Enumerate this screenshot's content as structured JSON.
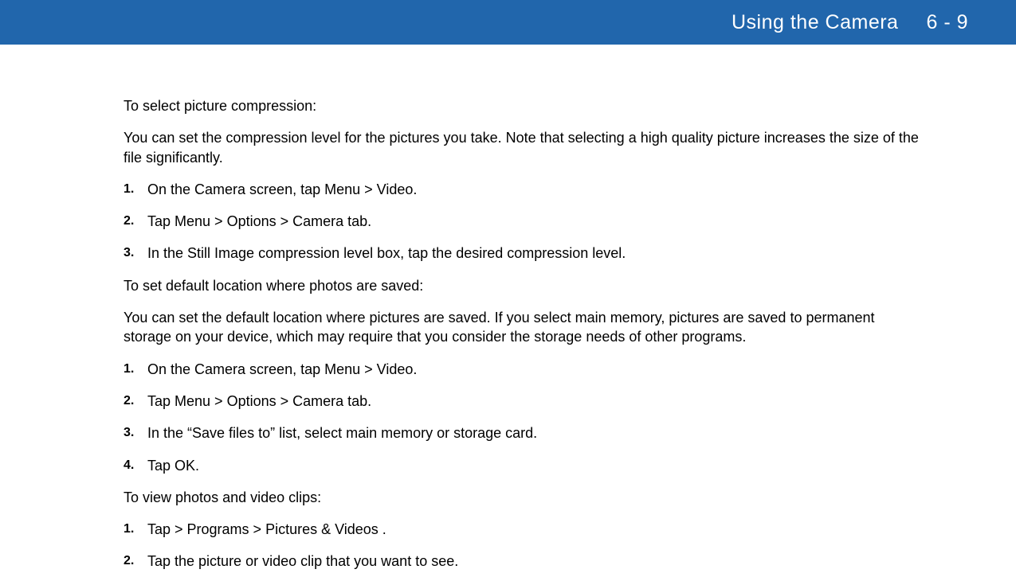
{
  "header": {
    "title": "Using the Camera",
    "page": "6 - 9"
  },
  "sections": [
    {
      "intro": "To select picture compression:",
      "desc": "You can set the compression level for the pictures you take. Note that selecting a high quality picture increases the size of the file significantly.",
      "steps": [
        "On the Camera screen, tap Menu > Video.",
        "Tap Menu > Options > Camera tab.",
        "In the Still Image compression level box, tap the desired compression level."
      ]
    },
    {
      "intro": "To set default location where photos are saved:",
      "desc": "You can set the default location where pictures are saved. If you select main memory, pictures are saved to permanent storage on your device, which may require that you consider the storage needs of other programs.",
      "steps": [
        "On the Camera screen, tap Menu > Video.",
        "Tap Menu > Options > Camera tab.",
        "In the “Save files to” list, select main memory or storage card.",
        "Tap OK."
      ]
    },
    {
      "intro": "To view photos and video clips:",
      "desc": "",
      "steps": [
        "Tap > Programs > Pictures & Videos .",
        "Tap the picture or video clip that you want to see."
      ]
    }
  ]
}
